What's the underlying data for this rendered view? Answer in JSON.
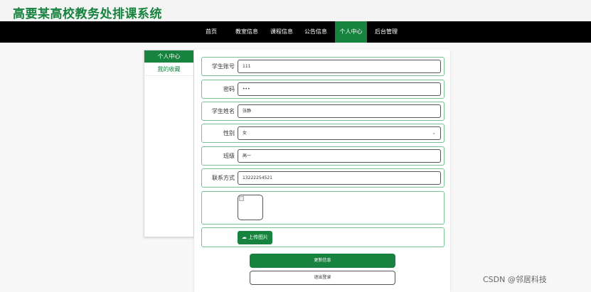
{
  "site": {
    "title": "高要某高校教务处排课系统"
  },
  "nav": {
    "items": [
      {
        "label": "首页"
      },
      {
        "label": "教室信息"
      },
      {
        "label": "课程信息"
      },
      {
        "label": "公告信息"
      },
      {
        "label": "个人中心"
      },
      {
        "label": "后台管理"
      }
    ],
    "active": "个人中心"
  },
  "sidebar": {
    "items": [
      {
        "label": "个人中心"
      },
      {
        "label": "我的收藏"
      }
    ]
  },
  "form": {
    "student_no": {
      "label": "学生账号",
      "value": "111"
    },
    "password": {
      "label": "密码",
      "value": "•••"
    },
    "student_name": {
      "label": "学生姓名",
      "value": "张静"
    },
    "gender": {
      "label": "性别",
      "value": "女"
    },
    "class": {
      "label": "班级",
      "value": "高一"
    },
    "phone": {
      "label": "联系方式",
      "value": "13222254521"
    },
    "upload_label": "上传图片"
  },
  "actions": {
    "update_label": "更新信息",
    "logout_label": "退出登录"
  },
  "watermark": "CSDN @邻居科技",
  "colors": {
    "accent": "#17833f",
    "nav_bg": "#000000"
  }
}
